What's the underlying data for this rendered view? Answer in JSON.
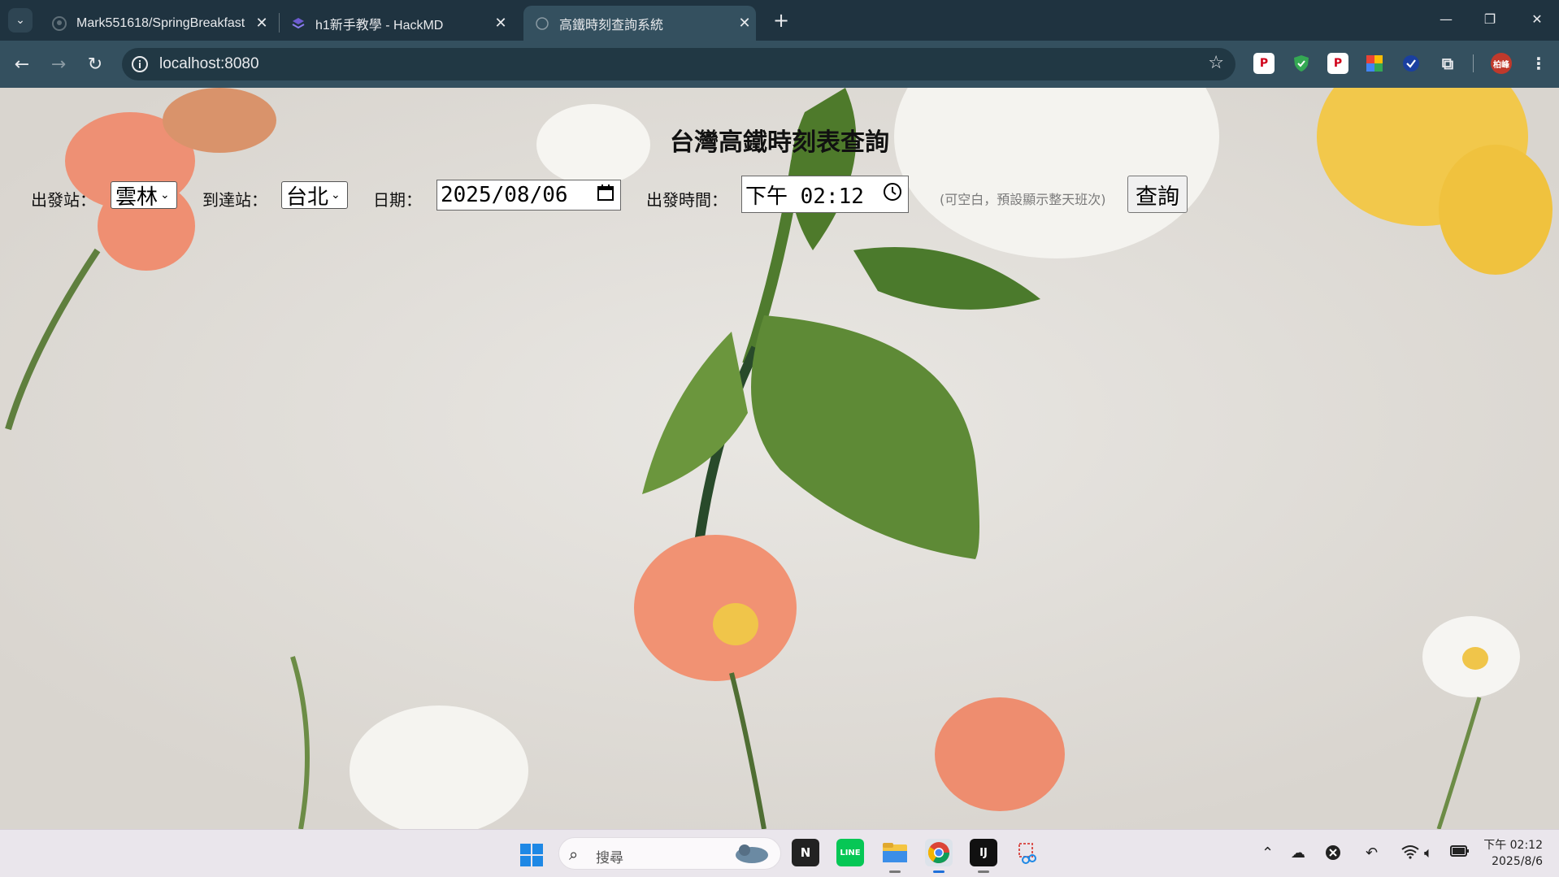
{
  "browser": {
    "tabs": [
      {
        "title": "Mark551618/SpringBreakfast",
        "icon": "github-icon",
        "active": false
      },
      {
        "title": "h1新手教學 - HackMD",
        "icon": "hackmd-icon",
        "active": false
      },
      {
        "title": "高鐵時刻查詢系統",
        "icon": "globe-icon",
        "active": true
      }
    ],
    "url": "localhost:8080",
    "profile_label": "柏峰"
  },
  "page": {
    "title": "台灣高鐵時刻表查詢",
    "departure_label": "出發站：",
    "departure_value": "雲林",
    "arrival_label": "到達站：",
    "arrival_value": "台北",
    "date_label": "日期：",
    "date_value": "2025/08/06",
    "time_label": "出發時間：",
    "time_value": "下午 02:12",
    "hint": "(可空白，預設顯示整天班次)",
    "query_button": "查詢"
  },
  "taskbar": {
    "search_placeholder": "搜尋",
    "time": "下午 02:12",
    "date": "2025/8/6"
  }
}
